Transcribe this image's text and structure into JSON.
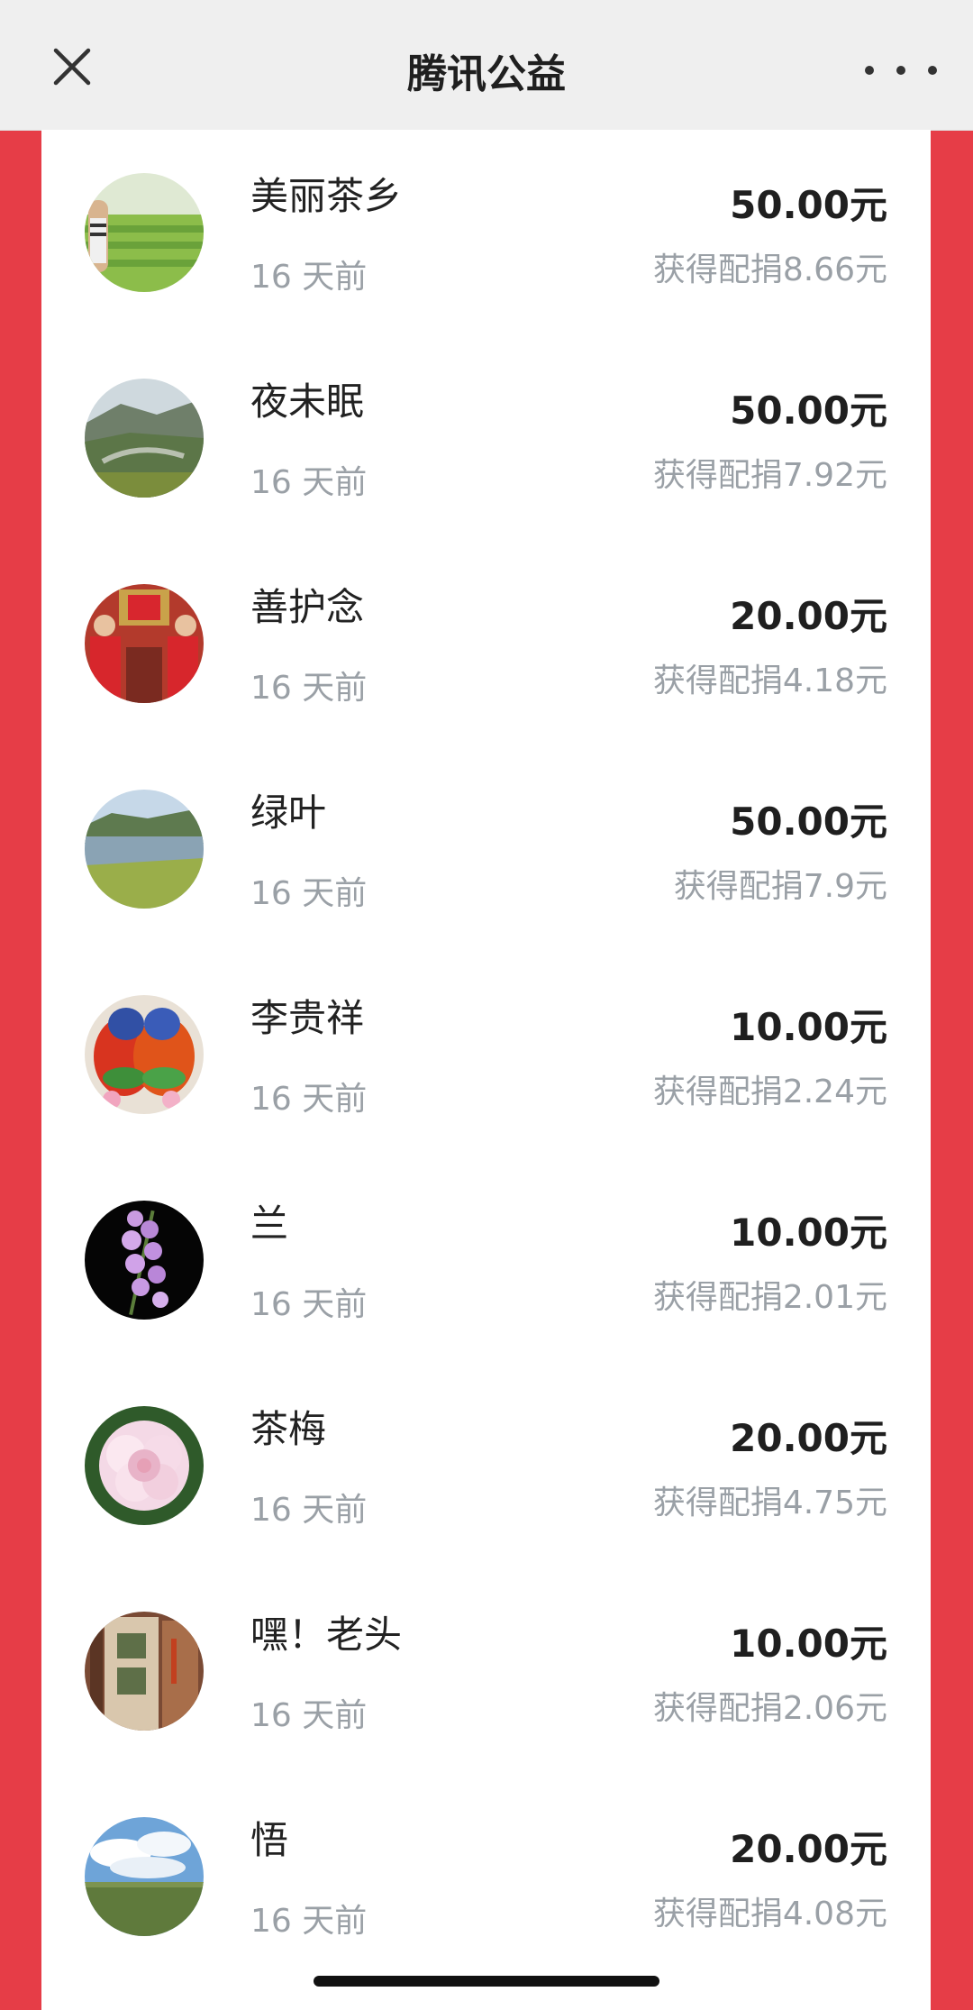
{
  "header": {
    "title": "腾讯公益",
    "close_icon": "close-icon",
    "more_icon": "more-icon"
  },
  "donations": [
    {
      "name": "美丽茶乡",
      "time": "16 天前",
      "amount": "50.00元",
      "match": "获得配捐8.66元",
      "avatar": "tea-field-avatar"
    },
    {
      "name": "夜未眠",
      "time": "16 天前",
      "amount": "50.00元",
      "match": "获得配捐7.92元",
      "avatar": "mountain-valley-avatar"
    },
    {
      "name": "善护念",
      "time": "16 天前",
      "amount": "20.00元",
      "match": "获得配捐4.18元",
      "avatar": "wedding-couple-avatar"
    },
    {
      "name": "绿叶",
      "time": "16 天前",
      "amount": "50.00元",
      "match": "获得配捐7.9元",
      "avatar": "lake-avatar"
    },
    {
      "name": "李贵祥",
      "time": "16 天前",
      "amount": "10.00元",
      "match": "获得配捐2.24元",
      "avatar": "parrots-avatar"
    },
    {
      "name": "兰",
      "time": "16 天前",
      "amount": "10.00元",
      "match": "获得配捐2.01元",
      "avatar": "orchid-avatar"
    },
    {
      "name": "茶梅",
      "time": "16 天前",
      "amount": "20.00元",
      "match": "获得配捐4.75元",
      "avatar": "peony-avatar"
    },
    {
      "name": "嘿！老头",
      "time": "16 天前",
      "amount": "10.00元",
      "match": "获得配捐2.06元",
      "avatar": "ice-island-sign-avatar"
    },
    {
      "name": "悟",
      "time": "16 天前",
      "amount": "20.00元",
      "match": "获得配捐4.08元",
      "avatar": "sky-grassland-avatar"
    }
  ]
}
